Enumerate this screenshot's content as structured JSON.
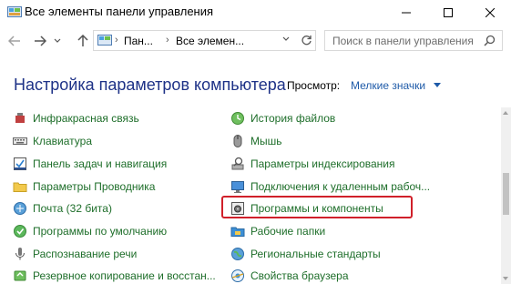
{
  "window": {
    "title": "Все элементы панели управления"
  },
  "address": {
    "segments": [
      "Пан...",
      "Все элемен..."
    ],
    "search_placeholder": "Поиск в панели управления"
  },
  "header": {
    "title": "Настройка параметров компьютера",
    "view_label": "Просмотр:",
    "view_value": "Мелкие значки"
  },
  "items": {
    "left": [
      {
        "label": "Инфракрасная связь",
        "icon": "infrared-icon"
      },
      {
        "label": "Клавиатура",
        "icon": "keyboard-icon"
      },
      {
        "label": "Панель задач и навигация",
        "icon": "taskbar-icon"
      },
      {
        "label": "Параметры Проводника",
        "icon": "folder-options-icon"
      },
      {
        "label": "Почта (32 бита)",
        "icon": "mail-icon"
      },
      {
        "label": "Программы по умолчанию",
        "icon": "default-programs-icon"
      },
      {
        "label": "Распознавание речи",
        "icon": "microphone-icon"
      },
      {
        "label": "Резервное копирование и восстан...",
        "icon": "backup-icon"
      }
    ],
    "right": [
      {
        "label": "История файлов",
        "icon": "file-history-icon"
      },
      {
        "label": "Мышь",
        "icon": "mouse-icon"
      },
      {
        "label": "Параметры индексирования",
        "icon": "indexing-icon"
      },
      {
        "label": "Подключения к удаленным рабоч...",
        "icon": "remote-desktop-icon"
      },
      {
        "label": "Программы и компоненты",
        "icon": "programs-features-icon"
      },
      {
        "label": "Рабочие папки",
        "icon": "work-folders-icon"
      },
      {
        "label": "Региональные стандарты",
        "icon": "region-icon"
      },
      {
        "label": "Свойства браузера",
        "icon": "browser-properties-icon"
      }
    ]
  },
  "colors": {
    "link_green": "#1e6e2a",
    "title_blue": "#1e3287",
    "highlight_red": "#d0202a"
  }
}
